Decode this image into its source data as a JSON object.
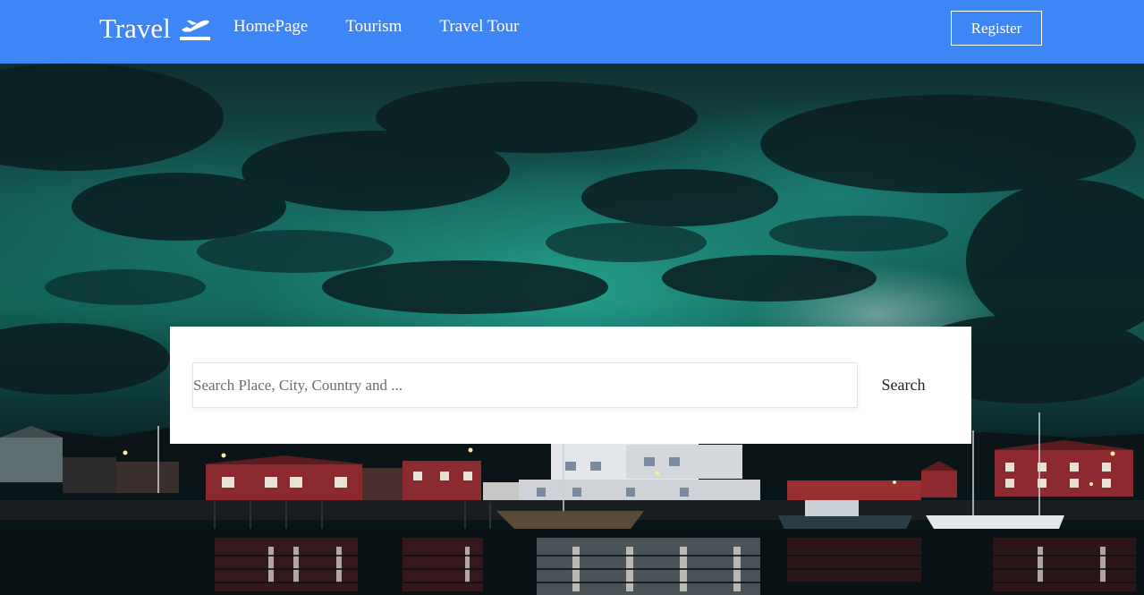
{
  "header": {
    "brand": "Travel",
    "brand_icon": "airplane-departure-icon",
    "nav": [
      {
        "label": "HomePage"
      },
      {
        "label": "Tourism"
      },
      {
        "label": "Travel Tour"
      }
    ],
    "register_label": "Register"
  },
  "search": {
    "placeholder": "Search Place, City, Country and ...",
    "value": "",
    "button_label": "Search"
  },
  "colors": {
    "header_bg": "#3e86f5",
    "text_light": "#ffffff"
  }
}
